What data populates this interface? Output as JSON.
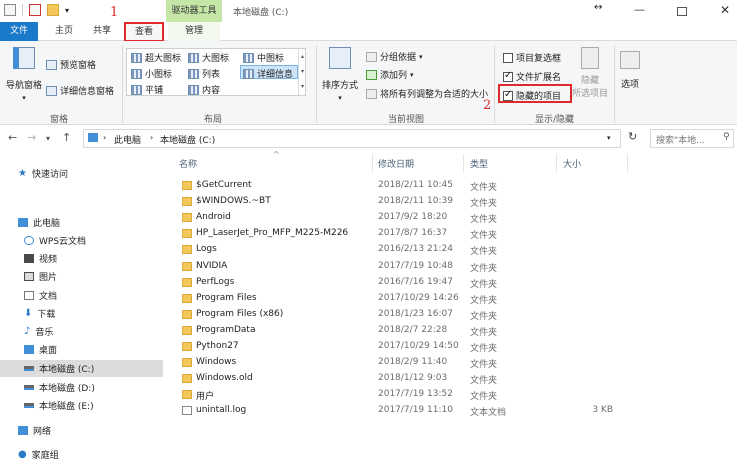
{
  "titlebar": {
    "context_tab": "驱动器工具",
    "title": "本地磁盘 (C:)"
  },
  "tabs": {
    "file": "文件",
    "home": "主页",
    "share": "共享",
    "view": "查看",
    "manage": "管理"
  },
  "annotations": {
    "one": "1",
    "two": "2"
  },
  "ribbon": {
    "panes": {
      "nav_pane": "导航窗格",
      "preview_pane": "预览窗格",
      "details_pane": "详细信息窗格",
      "label": "窗格"
    },
    "layout": {
      "xl_icons": "超大图标",
      "large_icons": "大图标",
      "medium_icons": "中图标",
      "small_icons": "小图标",
      "list": "列表",
      "details": "详细信息",
      "tiles": "平铺",
      "content": "内容",
      "label": "布局"
    },
    "current_view": {
      "sort_by": "排序方式",
      "group_by": "分组依据",
      "add_columns": "添加列",
      "fit_columns": "将所有列调整为合适的大小",
      "label": "当前视图"
    },
    "show_hide": {
      "item_checkboxes": "项目复选框",
      "file_extensions": "文件扩展名",
      "hidden_items": "隐藏的项目",
      "hide_selected_1": "隐藏",
      "hide_selected_2": "所选项目",
      "label": "显示/隐藏",
      "item_checkboxes_checked": false,
      "file_extensions_checked": true,
      "hidden_items_checked": true
    },
    "options": "选项"
  },
  "address": {
    "crumbs": [
      "此电脑",
      "本地磁盘 (C:)"
    ],
    "search_placeholder": "搜索\"本地..."
  },
  "nav_pane": {
    "quick_access": "快速访问",
    "this_pc": "此电脑",
    "items": [
      "WPS云文档",
      "视频",
      "图片",
      "文档",
      "下载",
      "音乐",
      "桌面",
      "本地磁盘 (C:)",
      "本地磁盘 (D:)",
      "本地磁盘 (E:)"
    ],
    "network": "网络",
    "homegroup": "家庭组"
  },
  "columns": {
    "name": "名称",
    "modified": "修改日期",
    "type": "类型",
    "size": "大小"
  },
  "files": [
    {
      "name": "$GetCurrent",
      "date": "2018/2/11 10:45",
      "type": "文件夹",
      "size": ""
    },
    {
      "name": "$WINDOWS.~BT",
      "date": "2018/2/11 10:39",
      "type": "文件夹",
      "size": ""
    },
    {
      "name": "Android",
      "date": "2017/9/2 18:20",
      "type": "文件夹",
      "size": ""
    },
    {
      "name": "HP_LaserJet_Pro_MFP_M225-M226",
      "date": "2017/8/7 16:37",
      "type": "文件夹",
      "size": ""
    },
    {
      "name": "Logs",
      "date": "2016/2/13 21:24",
      "type": "文件夹",
      "size": ""
    },
    {
      "name": "NVIDIA",
      "date": "2017/7/19 10:48",
      "type": "文件夹",
      "size": ""
    },
    {
      "name": "PerfLogs",
      "date": "2016/7/16 19:47",
      "type": "文件夹",
      "size": ""
    },
    {
      "name": "Program Files",
      "date": "2017/10/29 14:26",
      "type": "文件夹",
      "size": ""
    },
    {
      "name": "Program Files (x86)",
      "date": "2018/1/23 16:07",
      "type": "文件夹",
      "size": ""
    },
    {
      "name": "ProgramData",
      "date": "2018/2/7 22:28",
      "type": "文件夹",
      "size": ""
    },
    {
      "name": "Python27",
      "date": "2017/10/29 14:50",
      "type": "文件夹",
      "size": ""
    },
    {
      "name": "Windows",
      "date": "2018/2/9 11:40",
      "type": "文件夹",
      "size": ""
    },
    {
      "name": "Windows.old",
      "date": "2018/1/12 9:03",
      "type": "文件夹",
      "size": ""
    },
    {
      "name": "用户",
      "date": "2017/7/19 13:52",
      "type": "文件夹",
      "size": ""
    },
    {
      "name": "unintall.log",
      "date": "2017/7/19 11:10",
      "type": "文本文档",
      "size": "3 KB"
    }
  ]
}
